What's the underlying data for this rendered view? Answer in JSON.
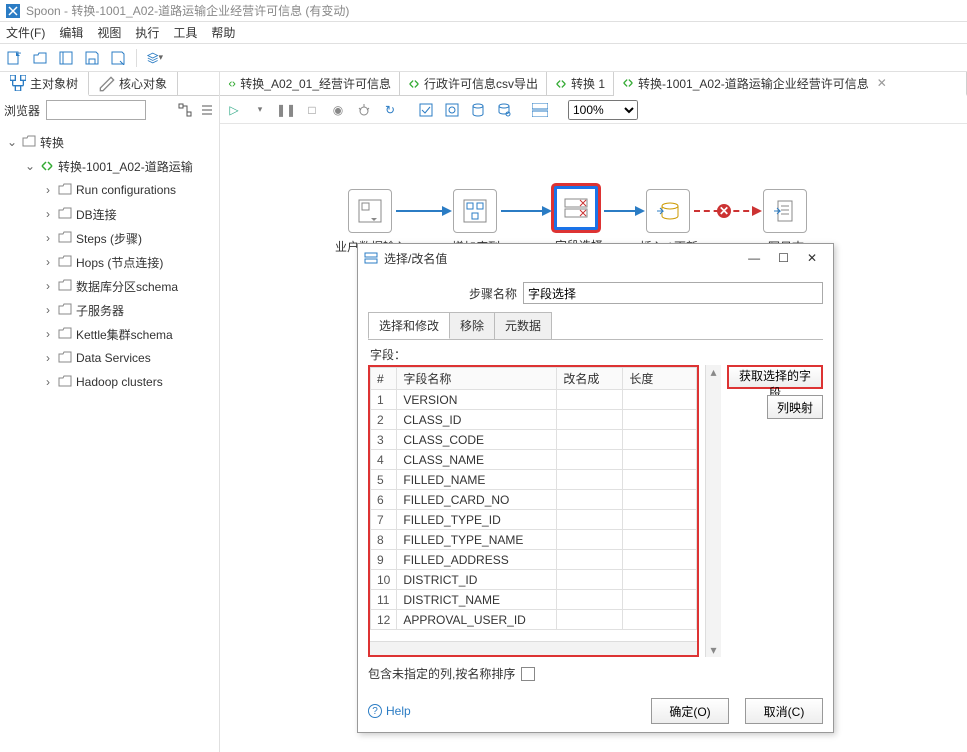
{
  "title": "Spoon - 转换-1001_A02-道路运输企业经营许可信息 (有变动)",
  "menu": [
    "文件(F)",
    "编辑",
    "视图",
    "执行",
    "工具",
    "帮助"
  ],
  "sidebar": {
    "tabs": [
      "主对象树",
      "核心对象"
    ],
    "browser_label": "浏览器",
    "root": "转换",
    "trans_node": "转换-1001_A02-道路运输",
    "children": [
      "Run configurations",
      "DB连接",
      "Steps (步骤)",
      "Hops (节点连接)",
      "数据库分区schema",
      "子服务器",
      "Kettle集群schema",
      "Data Services",
      "Hadoop clusters"
    ]
  },
  "ws": {
    "tabs": [
      {
        "label": "转换_A02_01_经营许可信息"
      },
      {
        "label": "行政许可信息csv导出"
      },
      {
        "label": "转换 1"
      },
      {
        "label": "转换-1001_A02-道路运输企业经营许可信息",
        "active": true
      }
    ],
    "zoom": "100%",
    "steps": [
      "业户数据输入",
      "增加序列",
      "字段选择",
      "插入 / 更新",
      "写日志"
    ]
  },
  "dialog": {
    "title": "选择/改名值",
    "step_name_label": "步骤名称",
    "step_name_value": "字段选择",
    "tabs": [
      "选择和修改",
      "移除",
      "元数据"
    ],
    "fields_label": "字段：",
    "columns": [
      "#",
      "字段名称",
      "改名成",
      "长度"
    ],
    "rows": [
      {
        "n": 1,
        "name": "VERSION"
      },
      {
        "n": 2,
        "name": "CLASS_ID"
      },
      {
        "n": 3,
        "name": "CLASS_CODE"
      },
      {
        "n": 4,
        "name": "CLASS_NAME"
      },
      {
        "n": 5,
        "name": "FILLED_NAME"
      },
      {
        "n": 6,
        "name": "FILLED_CARD_NO"
      },
      {
        "n": 7,
        "name": "FILLED_TYPE_ID"
      },
      {
        "n": 8,
        "name": "FILLED_TYPE_NAME"
      },
      {
        "n": 9,
        "name": "FILLED_ADDRESS"
      },
      {
        "n": 10,
        "name": "DISTRICT_ID"
      },
      {
        "n": 11,
        "name": "DISTRICT_NAME"
      },
      {
        "n": 12,
        "name": "APPROVAL_USER_ID"
      }
    ],
    "btn_get_fields": "获取选择的字段",
    "btn_map": "列映射",
    "include_label": "包含未指定的列,按名称排序",
    "help": "Help",
    "ok": "确定(O)",
    "cancel": "取消(C)"
  }
}
